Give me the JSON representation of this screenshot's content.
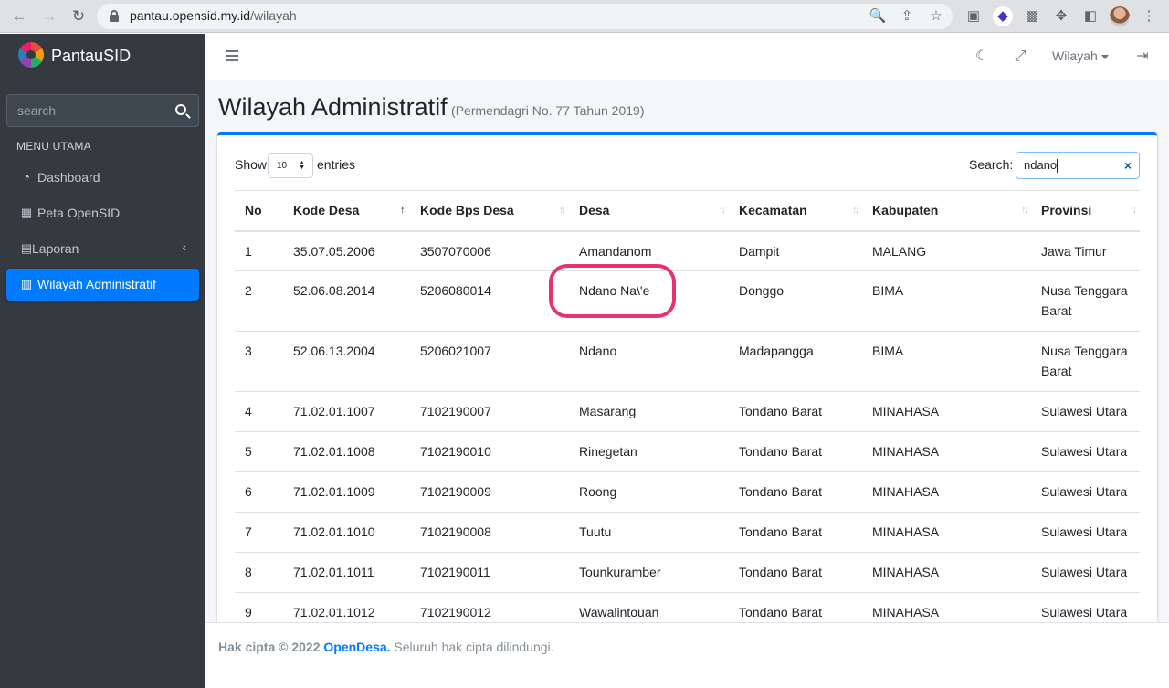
{
  "browser": {
    "url_host": "pantau.opensid.my.id",
    "url_path": "/wilayah",
    "back_icon": "←",
    "forward_icon": "→",
    "reload_icon": "↻",
    "zoom_icon": "🔍",
    "share_icon": "⇪",
    "star_icon": "☆",
    "menu_icon": "⋮"
  },
  "sidebar": {
    "brand_bold": "Pantau",
    "brand_light": "SID",
    "search_placeholder": "search",
    "menu_header": "MENU UTAMA",
    "items": [
      {
        "label": "Dashboard",
        "icon": "◔"
      },
      {
        "label": "Peta OpenSID",
        "icon": "▦"
      },
      {
        "label": "Laporan",
        "icon": "▤",
        "chevron": "‹"
      },
      {
        "label": "Wilayah Administratif",
        "icon": "▥"
      }
    ]
  },
  "navbar": {
    "dark_mode_icon": "☾",
    "fullscreen_icon": "⤢",
    "dropdown_label": "Wilayah",
    "logout_icon": "⇥"
  },
  "page": {
    "title": "Wilayah Administratif",
    "subtitle": "(Permendagri No. 77 Tahun 2019)"
  },
  "datatable": {
    "show_label": "Show",
    "entries_label": "entries",
    "page_size": "10",
    "search_label": "Search:",
    "search_value": "ndano",
    "clear_icon": "×",
    "columns": [
      "No",
      "Kode Desa",
      "Kode Bps Desa",
      "Desa",
      "Kecamatan",
      "Kabupaten",
      "Provinsi"
    ],
    "rows": [
      {
        "no": "1",
        "kode_desa": "35.07.05.2006",
        "kode_bps": "3507070006",
        "desa": "Amandanom",
        "kecamatan": "Dampit",
        "kabupaten": "MALANG",
        "provinsi": "Jawa Timur"
      },
      {
        "no": "2",
        "kode_desa": "52.06.08.2014",
        "kode_bps": "5206080014",
        "desa": "Ndano Na\\'e",
        "kecamatan": "Donggo",
        "kabupaten": "BIMA",
        "provinsi": "Nusa Tenggara Barat"
      },
      {
        "no": "3",
        "kode_desa": "52.06.13.2004",
        "kode_bps": "5206021007",
        "desa": "Ndano",
        "kecamatan": "Madapangga",
        "kabupaten": "BIMA",
        "provinsi": "Nusa Tenggara Barat"
      },
      {
        "no": "4",
        "kode_desa": "71.02.01.1007",
        "kode_bps": "7102190007",
        "desa": "Masarang",
        "kecamatan": "Tondano Barat",
        "kabupaten": "MINAHASA",
        "provinsi": "Sulawesi Utara"
      },
      {
        "no": "5",
        "kode_desa": "71.02.01.1008",
        "kode_bps": "7102190010",
        "desa": "Rinegetan",
        "kecamatan": "Tondano Barat",
        "kabupaten": "MINAHASA",
        "provinsi": "Sulawesi Utara"
      },
      {
        "no": "6",
        "kode_desa": "71.02.01.1009",
        "kode_bps": "7102190009",
        "desa": "Roong",
        "kecamatan": "Tondano Barat",
        "kabupaten": "MINAHASA",
        "provinsi": "Sulawesi Utara"
      },
      {
        "no": "7",
        "kode_desa": "71.02.01.1010",
        "kode_bps": "7102190008",
        "desa": "Tuutu",
        "kecamatan": "Tondano Barat",
        "kabupaten": "MINAHASA",
        "provinsi": "Sulawesi Utara"
      },
      {
        "no": "8",
        "kode_desa": "71.02.01.1011",
        "kode_bps": "7102190011",
        "desa": "Tounkuramber",
        "kecamatan": "Tondano Barat",
        "kabupaten": "MINAHASA",
        "provinsi": "Sulawesi Utara"
      },
      {
        "no": "9",
        "kode_desa": "71.02.01.1012",
        "kode_bps": "7102190012",
        "desa": "Wawalintouan",
        "kecamatan": "Tondano Barat",
        "kabupaten": "MINAHASA",
        "provinsi": "Sulawesi Utara"
      }
    ]
  },
  "footer": {
    "copyright": "Hak cipta © 2022",
    "link": "OpenDesa.",
    "rights": "Seluruh hak cipta dilindungi."
  },
  "colors": {
    "accent": "#007bff",
    "sidebar_bg": "#343a40",
    "highlight_ring": "#e8326e"
  }
}
